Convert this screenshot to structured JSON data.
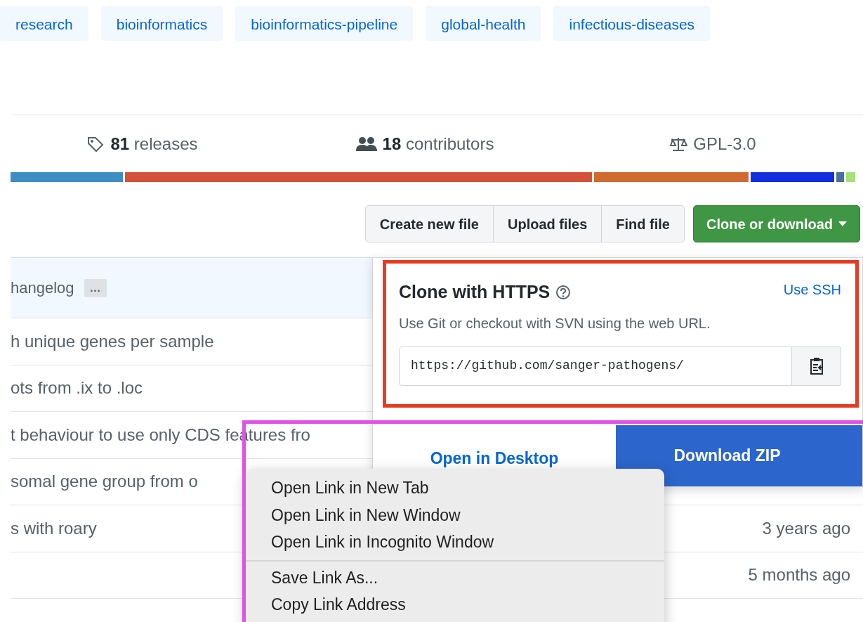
{
  "topics": [
    {
      "label": "research"
    },
    {
      "label": "bioinformatics"
    },
    {
      "label": "bioinformatics-pipeline"
    },
    {
      "label": "global-health"
    },
    {
      "label": "infectious-diseases"
    }
  ],
  "stats": [
    {
      "kind": "releases",
      "count": "81",
      "label": "releases"
    },
    {
      "kind": "contributors",
      "count": "18",
      "label": "contributors"
    },
    {
      "kind": "license",
      "label": "GPL-3.0"
    }
  ],
  "language_bar": [
    {
      "color": "#3e8ec4"
    },
    {
      "color": "#d4523a"
    },
    {
      "color": "#d06b2f"
    },
    {
      "color": "#1330e0"
    },
    {
      "color": "#4a6fa0"
    },
    {
      "color": "#a6e07a"
    }
  ],
  "file_buttons": [
    "Create new file",
    "Upload files",
    "Find file"
  ],
  "clone_button": {
    "label": "Clone or download"
  },
  "commits": {
    "header": {
      "message": "hangelog",
      "ellipsis": "…"
    },
    "rows": [
      {
        "message": "h unique genes per sample"
      },
      {
        "message": "ots from .ix to .loc"
      },
      {
        "message": "t behaviour to use only CDS features fro"
      },
      {
        "message": "somal gene group from o"
      },
      {
        "message": "s with roary",
        "age": "3 years ago"
      },
      {
        "age": "5 months ago"
      }
    ]
  },
  "clone_panel": {
    "title": "Clone with HTTPS",
    "switch_link": "Use SSH",
    "description": "Use Git or checkout with SVN using the web URL.",
    "url": "https://github.com/sanger-pathogens/",
    "open_desktop": "Open in Desktop",
    "download": "Download ZIP"
  },
  "context_menu": {
    "groups": [
      [
        "Open Link in New Tab",
        "Open Link in New Window",
        "Open Link in Incognito Window"
      ],
      [
        "Save Link As...",
        "Copy Link Address"
      ]
    ]
  },
  "highlights": [
    {
      "color": "#e43d21"
    },
    {
      "color": "#e052e6"
    }
  ]
}
